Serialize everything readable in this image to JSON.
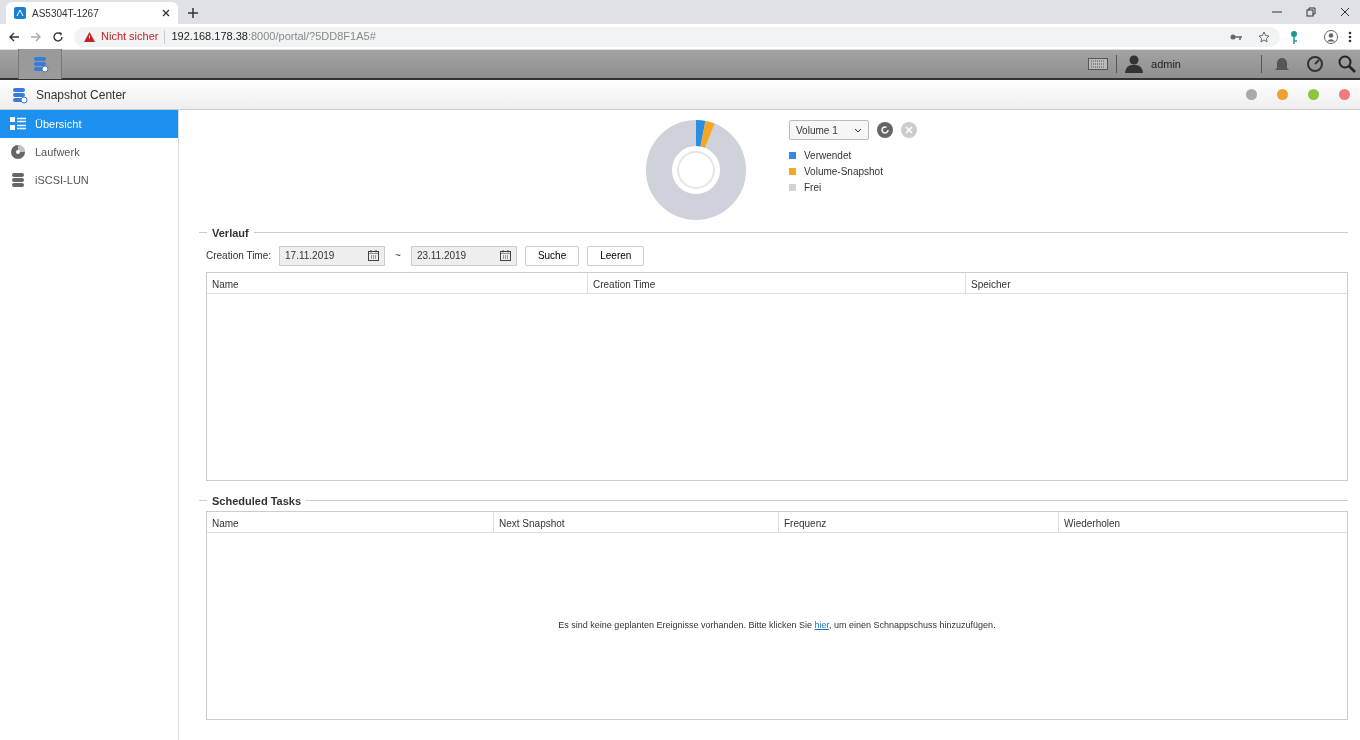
{
  "browser": {
    "tab_title": "AS5304T-1267",
    "security": "Nicht sicher",
    "url_host": "192.168.178.38",
    "url_rest": ":8000/portal/?5DD8F1A5#"
  },
  "topbar": {
    "user": "admin"
  },
  "app": {
    "title": "Snapshot Center"
  },
  "sidebar": {
    "items": [
      {
        "label": "Übersicht",
        "kind": "overview",
        "selected": true
      },
      {
        "label": "Laufwerk",
        "kind": "drive",
        "selected": false
      },
      {
        "label": "iSCSI-LUN",
        "kind": "lun",
        "selected": false
      }
    ]
  },
  "overview": {
    "volume_select": "Volume 1",
    "legend": [
      {
        "label": "Verwendet",
        "color": "#2b8ee0"
      },
      {
        "label": "Volume-Snapshot",
        "color": "#f5a623"
      },
      {
        "label": "Frei",
        "color": "#cfd2da"
      }
    ]
  },
  "history": {
    "title": "Verlauf",
    "filter_label": "Creation Time:",
    "date_from": "17.11.2019",
    "separator": "~",
    "date_to": "23.11.2019",
    "buttons": [
      "Suche",
      "Leeren"
    ],
    "columns": [
      "Name",
      "Creation Time",
      "Speicher"
    ]
  },
  "scheduled": {
    "title": "Scheduled Tasks",
    "columns": [
      "Name",
      "Next Snapshot",
      "Frequenz",
      "Wiederholen"
    ],
    "message_before": "Es sind keine geplanten Ereignisse vorhanden. Bitte klicken Sie",
    "link": "hier",
    "message_after": ", um einen Schnappschuss hinzuzufügen."
  }
}
